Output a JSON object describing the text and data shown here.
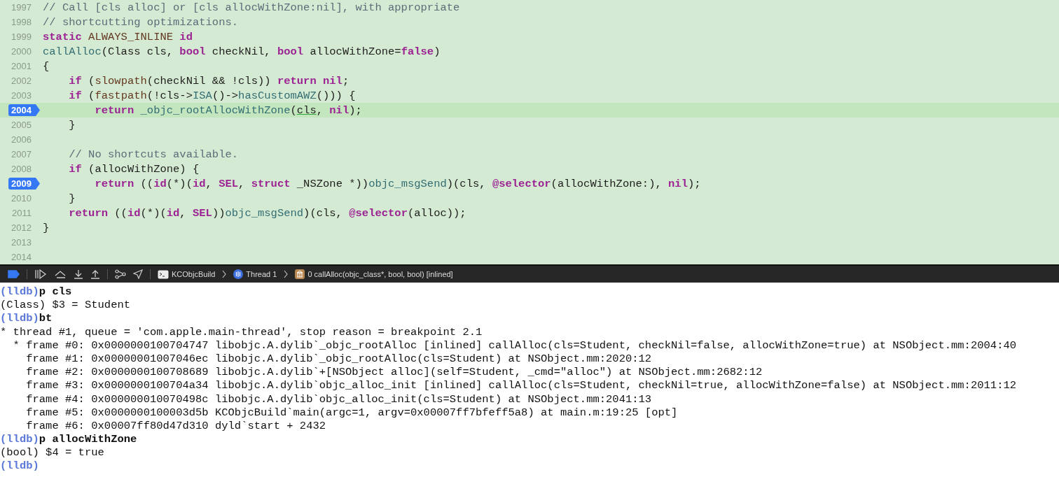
{
  "editor": {
    "lines": [
      {
        "number": "1997",
        "current": false,
        "breakpoint": false,
        "tokens": [
          {
            "kind": "comment",
            "text": "// Call [cls alloc] or [cls allocWithZone:nil], with appropriate"
          }
        ]
      },
      {
        "number": "1998",
        "current": false,
        "breakpoint": false,
        "tokens": [
          {
            "kind": "comment",
            "text": "// shortcutting optimizations."
          }
        ]
      },
      {
        "number": "1999",
        "current": false,
        "breakpoint": false,
        "tokens": [
          {
            "kind": "keyword",
            "text": "static"
          },
          {
            "kind": "macro",
            "text": " ALWAYS_INLINE"
          },
          {
            "kind": "keyword",
            "text": " id"
          }
        ]
      },
      {
        "number": "2000",
        "current": false,
        "breakpoint": false,
        "tokens": [
          {
            "kind": "func",
            "text": "callAlloc"
          },
          {
            "kind": "plain",
            "text": "(Class cls, "
          },
          {
            "kind": "keyword",
            "text": "bool"
          },
          {
            "kind": "plain",
            "text": " checkNil, "
          },
          {
            "kind": "keyword",
            "text": "bool"
          },
          {
            "kind": "plain",
            "text": " allocWithZone="
          },
          {
            "kind": "keyword",
            "text": "false"
          },
          {
            "kind": "plain",
            "text": ")"
          }
        ]
      },
      {
        "number": "2001",
        "current": false,
        "breakpoint": false,
        "tokens": [
          {
            "kind": "plain",
            "text": "{"
          }
        ]
      },
      {
        "number": "2002",
        "current": false,
        "breakpoint": false,
        "tokens": [
          {
            "kind": "keyword",
            "text": "    if"
          },
          {
            "kind": "plain",
            "text": " ("
          },
          {
            "kind": "macro",
            "text": "slowpath"
          },
          {
            "kind": "plain",
            "text": "(checkNil && !cls)) "
          },
          {
            "kind": "keyword",
            "text": "return"
          },
          {
            "kind": "keyword",
            "text": " nil"
          },
          {
            "kind": "plain",
            "text": ";"
          }
        ]
      },
      {
        "number": "2003",
        "current": false,
        "breakpoint": false,
        "tokens": [
          {
            "kind": "keyword",
            "text": "    if"
          },
          {
            "kind": "plain",
            "text": " ("
          },
          {
            "kind": "macro",
            "text": "fastpath"
          },
          {
            "kind": "plain",
            "text": "(!cls->"
          },
          {
            "kind": "func",
            "text": "ISA"
          },
          {
            "kind": "plain",
            "text": "()->"
          },
          {
            "kind": "func",
            "text": "hasCustomAWZ"
          },
          {
            "kind": "plain",
            "text": "())) {"
          }
        ]
      },
      {
        "number": "2004",
        "current": true,
        "breakpoint": true,
        "tokens": [
          {
            "kind": "keyword",
            "text": "        return"
          },
          {
            "kind": "func",
            "text": " _objc_rootAllocWithZone"
          },
          {
            "kind": "plain",
            "text": "("
          },
          {
            "kind": "marked",
            "text": "cls"
          },
          {
            "kind": "plain",
            "text": ", "
          },
          {
            "kind": "keyword",
            "text": "nil"
          },
          {
            "kind": "plain",
            "text": ");"
          }
        ]
      },
      {
        "number": "2005",
        "current": false,
        "breakpoint": false,
        "tokens": [
          {
            "kind": "plain",
            "text": "    }"
          }
        ]
      },
      {
        "number": "2006",
        "current": false,
        "breakpoint": false
      },
      {
        "number": "2007",
        "current": false,
        "breakpoint": false,
        "tokens": [
          {
            "kind": "comment",
            "text": "    // No shortcuts available."
          }
        ]
      },
      {
        "number": "2008",
        "current": false,
        "breakpoint": false,
        "tokens": [
          {
            "kind": "keyword",
            "text": "    if"
          },
          {
            "kind": "plain",
            "text": " (allocWithZone) {"
          }
        ]
      },
      {
        "number": "2009",
        "current": false,
        "breakpoint": true,
        "tokens": [
          {
            "kind": "keyword",
            "text": "        return"
          },
          {
            "kind": "plain",
            "text": " (("
          },
          {
            "kind": "keyword",
            "text": "id"
          },
          {
            "kind": "plain",
            "text": "(*)("
          },
          {
            "kind": "keyword",
            "text": "id"
          },
          {
            "kind": "plain",
            "text": ", "
          },
          {
            "kind": "keyword",
            "text": "SEL"
          },
          {
            "kind": "plain",
            "text": ", "
          },
          {
            "kind": "keyword",
            "text": "struct"
          },
          {
            "kind": "plain",
            "text": " _NSZone *))"
          },
          {
            "kind": "func",
            "text": "objc_msgSend"
          },
          {
            "kind": "plain",
            "text": ")(cls, "
          },
          {
            "kind": "keyword",
            "text": "@selector"
          },
          {
            "kind": "plain",
            "text": "(allocWithZone:), "
          },
          {
            "kind": "keyword",
            "text": "nil"
          },
          {
            "kind": "plain",
            "text": ");"
          }
        ]
      },
      {
        "number": "2010",
        "current": false,
        "breakpoint": false,
        "tokens": [
          {
            "kind": "plain",
            "text": "    }"
          }
        ]
      },
      {
        "number": "2011",
        "current": false,
        "breakpoint": false,
        "tokens": [
          {
            "kind": "keyword",
            "text": "    return"
          },
          {
            "kind": "plain",
            "text": " (("
          },
          {
            "kind": "keyword",
            "text": "id"
          },
          {
            "kind": "plain",
            "text": "(*)("
          },
          {
            "kind": "keyword",
            "text": "id"
          },
          {
            "kind": "plain",
            "text": ", "
          },
          {
            "kind": "keyword",
            "text": "SEL"
          },
          {
            "kind": "plain",
            "text": "))"
          },
          {
            "kind": "func",
            "text": "objc_msgSend"
          },
          {
            "kind": "plain",
            "text": ")(cls, "
          },
          {
            "kind": "keyword",
            "text": "@selector"
          },
          {
            "kind": "plain",
            "text": "(alloc));"
          }
        ]
      },
      {
        "number": "2012",
        "current": false,
        "breakpoint": false,
        "tokens": [
          {
            "kind": "plain",
            "text": "}"
          }
        ]
      },
      {
        "number": "2013",
        "current": false,
        "breakpoint": false
      },
      {
        "number": "2014",
        "current": false,
        "breakpoint": false
      }
    ]
  },
  "debug_bar": {
    "breakpoints_active": true,
    "breadcrumbs": [
      {
        "kind": "target",
        "label": "KCObjcBuild"
      },
      {
        "kind": "thread",
        "label": "Thread 1"
      },
      {
        "kind": "frame",
        "label": "0 callAlloc(objc_class*, bool, bool) [inlined]"
      }
    ]
  },
  "console": {
    "lines": [
      {
        "kind": "prompt",
        "prompt": "(lldb)",
        "command": "p cls"
      },
      {
        "kind": "output",
        "text": "(Class) $3 = Student"
      },
      {
        "kind": "prompt",
        "prompt": "(lldb)",
        "command": "bt"
      },
      {
        "kind": "output",
        "text": "* thread #1, queue = 'com.apple.main-thread', stop reason = breakpoint 2.1"
      },
      {
        "kind": "output",
        "text": "  * frame #0: 0x0000000100704747 libobjc.A.dylib`_objc_rootAlloc [inlined] callAlloc(cls=Student, checkNil=false, allocWithZone=true) at NSObject.mm:2004:40"
      },
      {
        "kind": "output",
        "text": "    frame #1: 0x00000001007046ec libobjc.A.dylib`_objc_rootAlloc(cls=Student) at NSObject.mm:2020:12"
      },
      {
        "kind": "output",
        "text": "    frame #2: 0x0000000100708689 libobjc.A.dylib`+[NSObject alloc](self=Student, _cmd=\"alloc\") at NSObject.mm:2682:12"
      },
      {
        "kind": "output",
        "text": "    frame #3: 0x0000000100704a34 libobjc.A.dylib`objc_alloc_init [inlined] callAlloc(cls=Student, checkNil=true, allocWithZone=false) at NSObject.mm:2011:12"
      },
      {
        "kind": "output",
        "text": "    frame #4: 0x000000010070498c libobjc.A.dylib`objc_alloc_init(cls=Student) at NSObject.mm:2041:13"
      },
      {
        "kind": "output",
        "text": "    frame #5: 0x0000000100003d5b KCObjcBuild`main(argc=1, argv=0x00007ff7bfeff5a8) at main.m:19:25 [opt]"
      },
      {
        "kind": "output",
        "text": "    frame #6: 0x00007ff80d47d310 dyld`start + 2432"
      },
      {
        "kind": "prompt",
        "prompt": "(lldb)",
        "command": "p allocWithZone"
      },
      {
        "kind": "output",
        "text": "(bool) $4 = true"
      },
      {
        "kind": "prompt",
        "prompt": "(lldb)"
      }
    ]
  }
}
